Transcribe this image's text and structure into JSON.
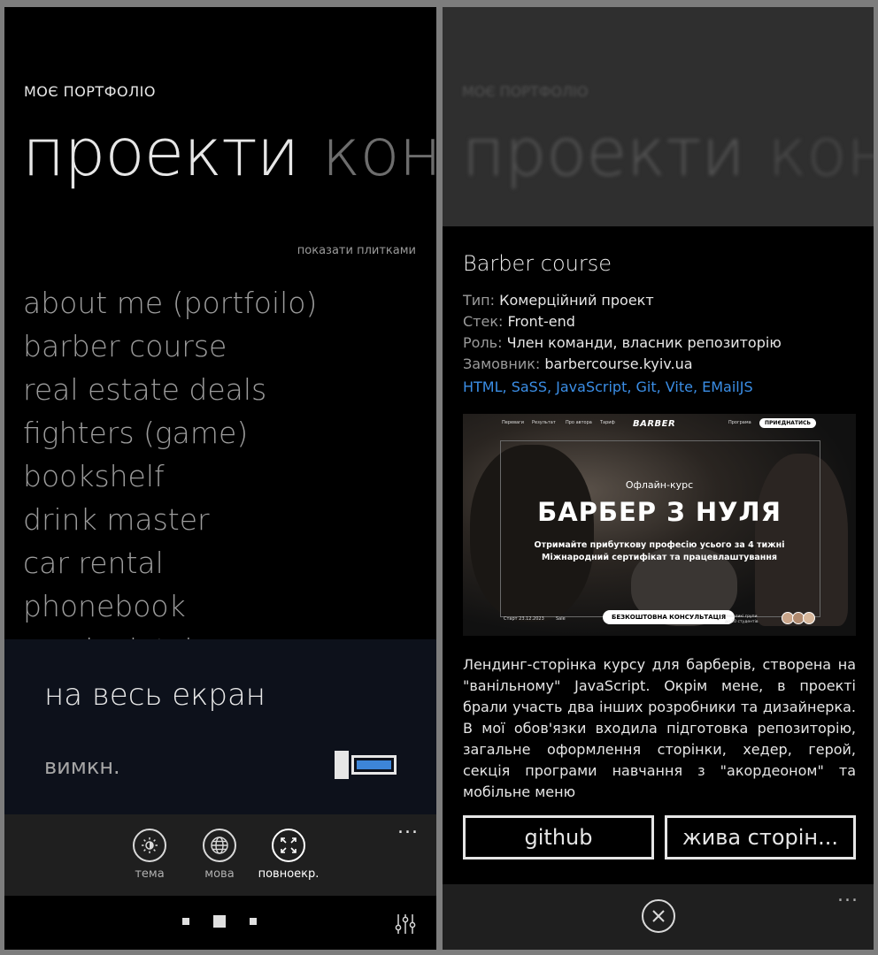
{
  "left": {
    "app_title": "МОЄ ПОРТФОЛІО",
    "pivot": {
      "active": "проекти",
      "next": "кон"
    },
    "tiles_link": "показати плитками",
    "projects": [
      "about me (portfoilo)",
      "barber course",
      "real estate deals",
      "fighters (game)",
      "bookshelf",
      "drink master",
      "car rental",
      "phonebook",
      "music database"
    ],
    "fullscreen_popup": {
      "title": "на весь екран",
      "state": "вимкн."
    },
    "appbar": {
      "more": "...",
      "buttons": [
        {
          "label": "тема",
          "icon": "brightness-icon"
        },
        {
          "label": "мова",
          "icon": "globe-icon"
        },
        {
          "label": "повноекр.",
          "icon": "fullscreen-icon"
        }
      ]
    }
  },
  "right": {
    "app_title": "МОЄ ПОРТФОЛІО",
    "pivot": {
      "active": "проекти",
      "next": "кон"
    },
    "project": {
      "title": "Barber course",
      "meta": [
        {
          "key": "Тип:",
          "value": "Комерційний проект"
        },
        {
          "key": "Стек:",
          "value": "Front-end"
        },
        {
          "key": "Роль:",
          "value": "Член команди, власник репозиторію"
        },
        {
          "key": "Замовник:",
          "value": "barbercourse.kyiv.ua"
        }
      ],
      "tech": "HTML, SaSS, JavaScript, Git, Vite, EMailJS",
      "screenshot": {
        "nav": [
          "Переваги",
          "Результат",
          "Про автора",
          "Тариф"
        ],
        "nav_right": "Програма",
        "logo": "BARBER",
        "join": "ПРИЄДНАТИСЬ",
        "subtitle": "Офлайн-курс",
        "headline": "БАРБЕР З НУЛЯ",
        "line1": "Отримайте прибуткову професію усього за 4 тижні",
        "line2": "Міжнародний сертифікат та працевлаштування",
        "cta": "БЕЗКОШТОВНА КОНСУЛЬТАЦІЯ",
        "start": "Старт 23.12.2023",
        "sale": "Sale",
        "group": "Невеликі групи\nдо 10 студентів"
      },
      "description": "Лендинг-сторінка курсу для барберів, створена на \"ванільному\" JavaScript. Окрім мене, в проекті брали участь два інших розробники та дизайнерка. В мої обов'язки входила підготовка репозиторію, загальне оформлення сторінки, хедер, герой, секція програми навчання з \"акордеоном\" та мобільне меню",
      "buttons": {
        "github": "github",
        "live": "жива сторін..."
      }
    },
    "appbar": {
      "more": "..."
    }
  },
  "colors": {
    "accent": "#3d85d8",
    "link": "#3b8ee6",
    "popup_bg": "#0d111b",
    "appbar_bg": "#1f1f1f"
  }
}
